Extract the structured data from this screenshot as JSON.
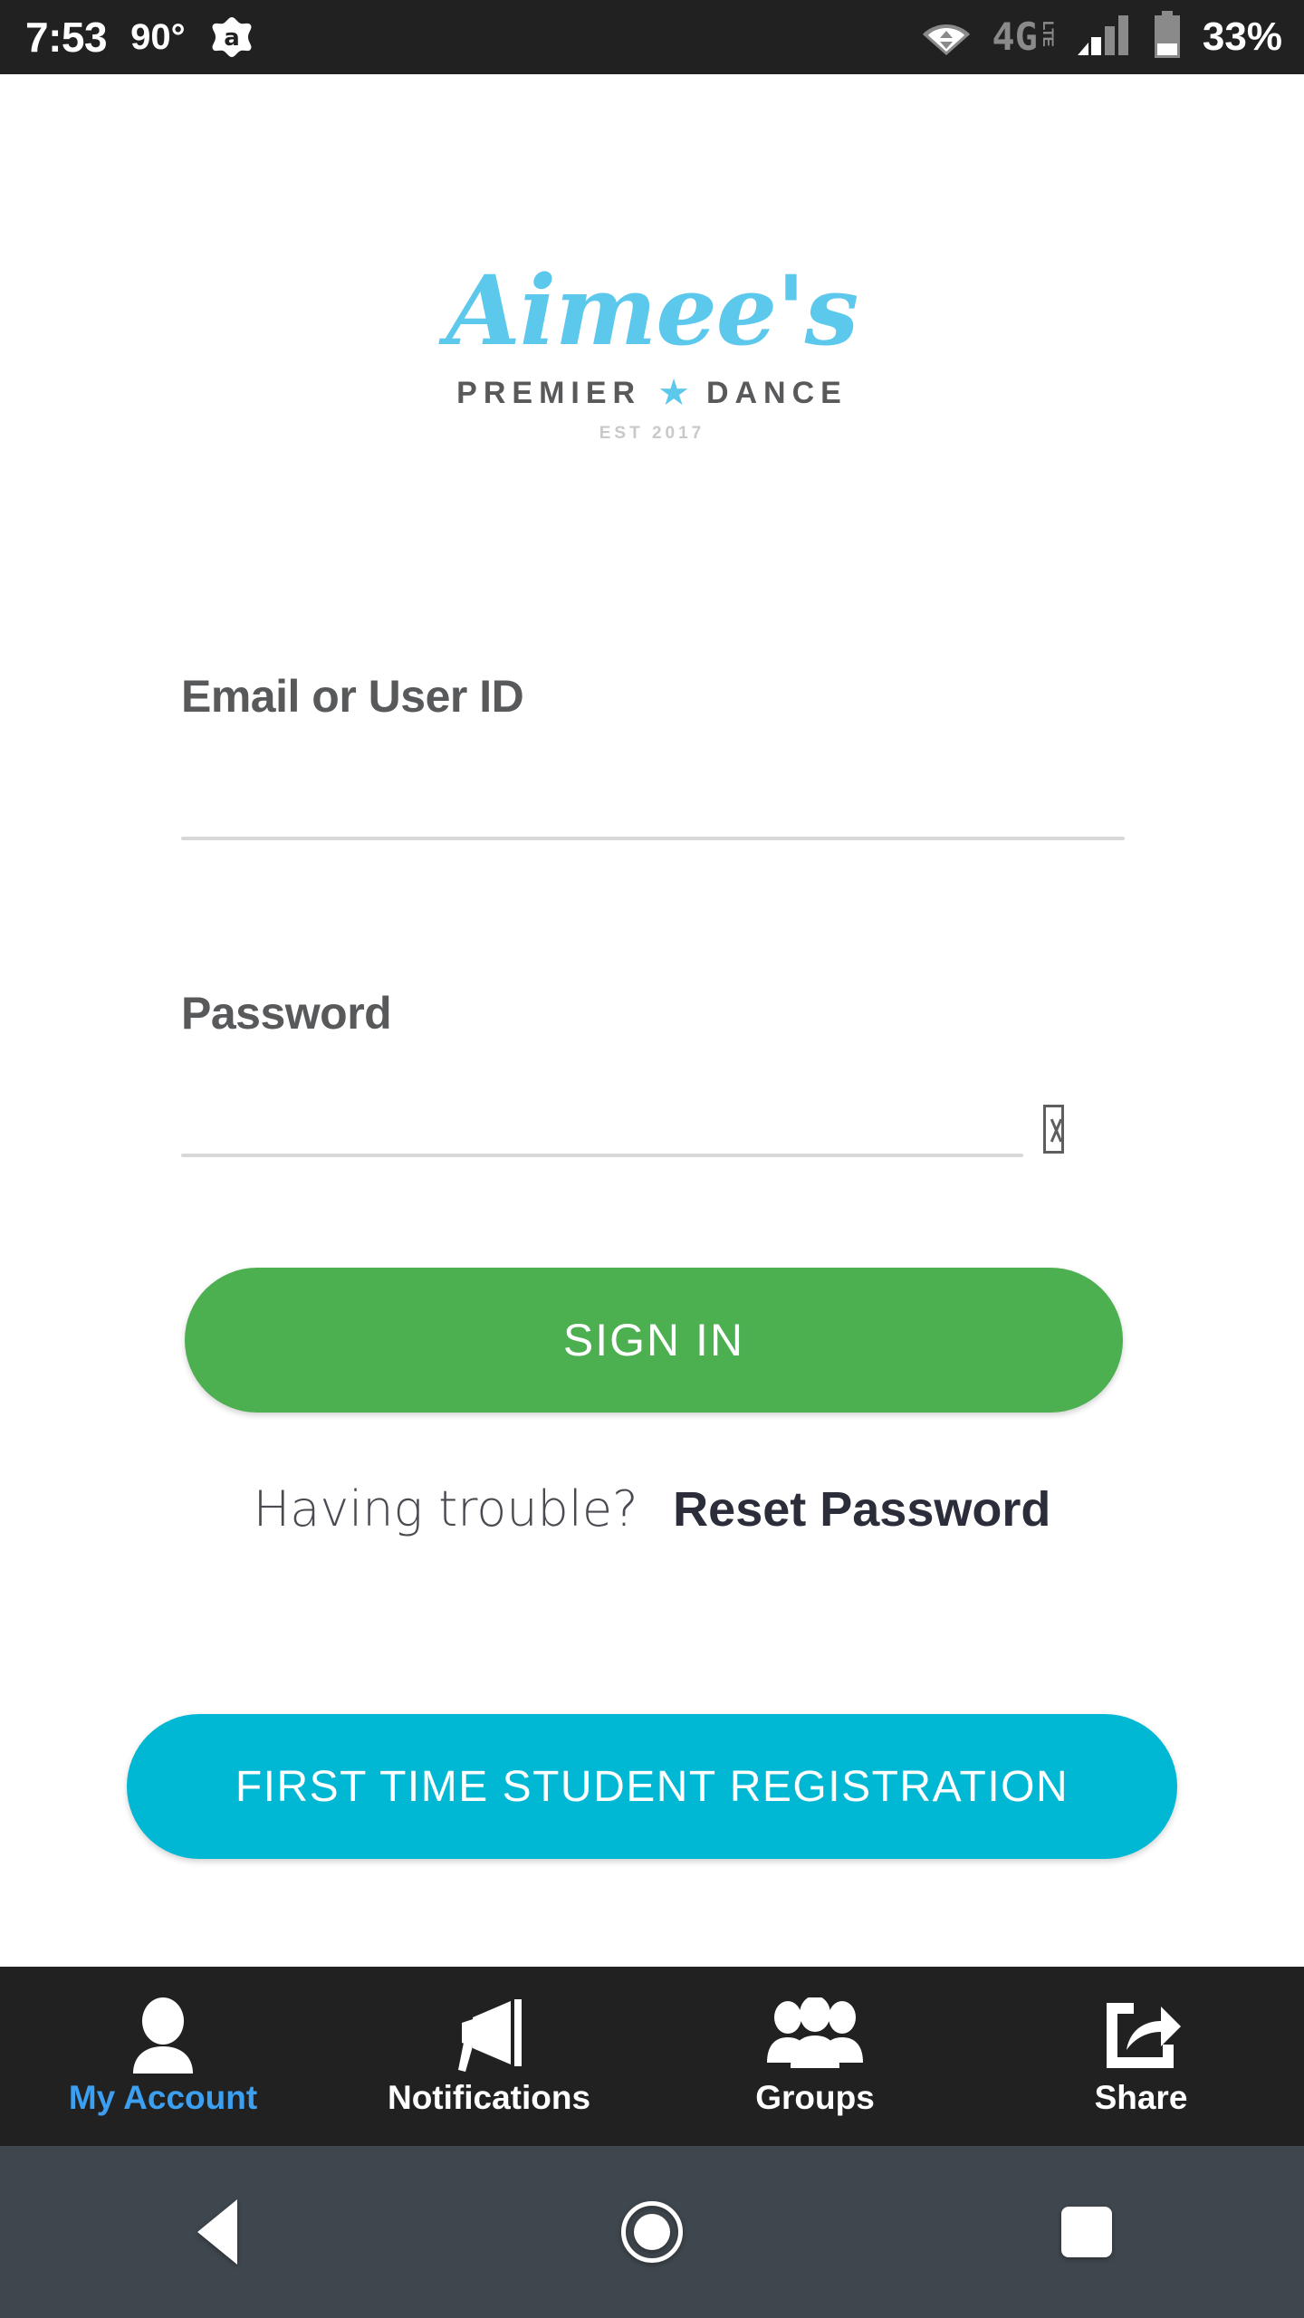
{
  "status_bar": {
    "time": "7:53",
    "temperature": "90°",
    "app_icon": "avast-icon",
    "wifi_icon": "wifi-icon",
    "network_label": "4G",
    "network_sub": "LTE",
    "signal_icon": "cellular-signal-icon",
    "battery_icon": "battery-icon",
    "battery_percent": "33%",
    "background_color": "#212121"
  },
  "logo": {
    "script_name": "Aimee's",
    "tagline_left": "PREMIER",
    "star_icon": "star-icon",
    "tagline_right": "DANCE",
    "established": "EST 2017",
    "script_color": "#5BC8EC",
    "tagline_color": "#58595B"
  },
  "form": {
    "email": {
      "label": "Email or User ID",
      "value": "",
      "placeholder": ""
    },
    "password": {
      "label": "Password",
      "value": "",
      "placeholder": "",
      "toggle_icon": "show-password-toggle-missing-glyph"
    }
  },
  "actions": {
    "sign_in_label": "SIGN IN",
    "sign_in_color": "#4CAF50",
    "register_label": "FIRST TIME STUDENT REGISTRATION",
    "register_color": "#00B8D4"
  },
  "help": {
    "question": "Having trouble?",
    "link_label": "Reset Password"
  },
  "tab_bar": {
    "background_color": "#212121",
    "active_color": "#3D9FEF",
    "items": [
      {
        "label": "My Account",
        "icon": "person-icon",
        "active": true
      },
      {
        "label": "Notifications",
        "icon": "megaphone-icon",
        "active": false
      },
      {
        "label": "Groups",
        "icon": "people-icon",
        "active": false
      },
      {
        "label": "Share",
        "icon": "share-icon",
        "active": false
      }
    ]
  },
  "android_nav": {
    "background_color": "#3F474E",
    "back_icon": "back-triangle-icon",
    "home_icon": "home-circle-icon",
    "recents_icon": "recents-square-icon"
  }
}
